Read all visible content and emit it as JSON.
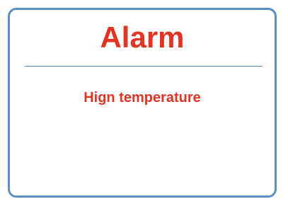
{
  "alarm": {
    "title": "Alarm",
    "message": "Hign temperature"
  },
  "colors": {
    "title_text": "#e53222",
    "message_text": "#e53222",
    "border": "#5a8fc7",
    "divider": "#4a86c5",
    "background": "#ffffff"
  }
}
